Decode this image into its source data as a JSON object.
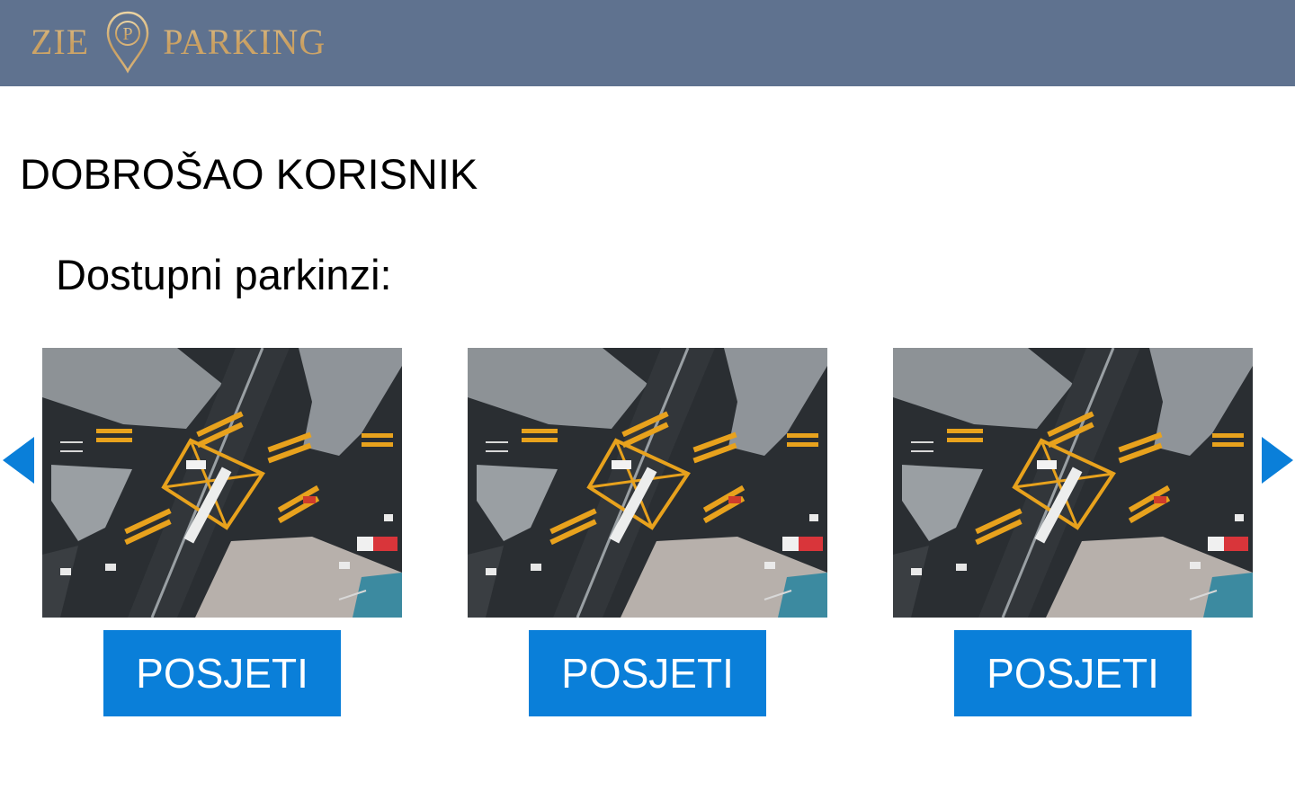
{
  "header": {
    "logo_left": "ZIE",
    "logo_right": "PARKING",
    "logo_pin_letter": "P",
    "bg_color": "#5f728f",
    "logo_color": "#d9b47a"
  },
  "main": {
    "welcome": "DOBROŠAO KORISNIK",
    "subtitle": "Dostupni parkinzi:"
  },
  "carousel": {
    "prev_icon": "caret-left-icon",
    "next_icon": "caret-right-icon",
    "arrow_color": "#0a7fd9",
    "cards": [
      {
        "image": "aerial-intersection-image",
        "button_label": "POSJETI"
      },
      {
        "image": "aerial-intersection-image",
        "button_label": "POSJETI"
      },
      {
        "image": "aerial-intersection-image",
        "button_label": "POSJETI"
      }
    ],
    "button_color": "#0a7fd9"
  }
}
